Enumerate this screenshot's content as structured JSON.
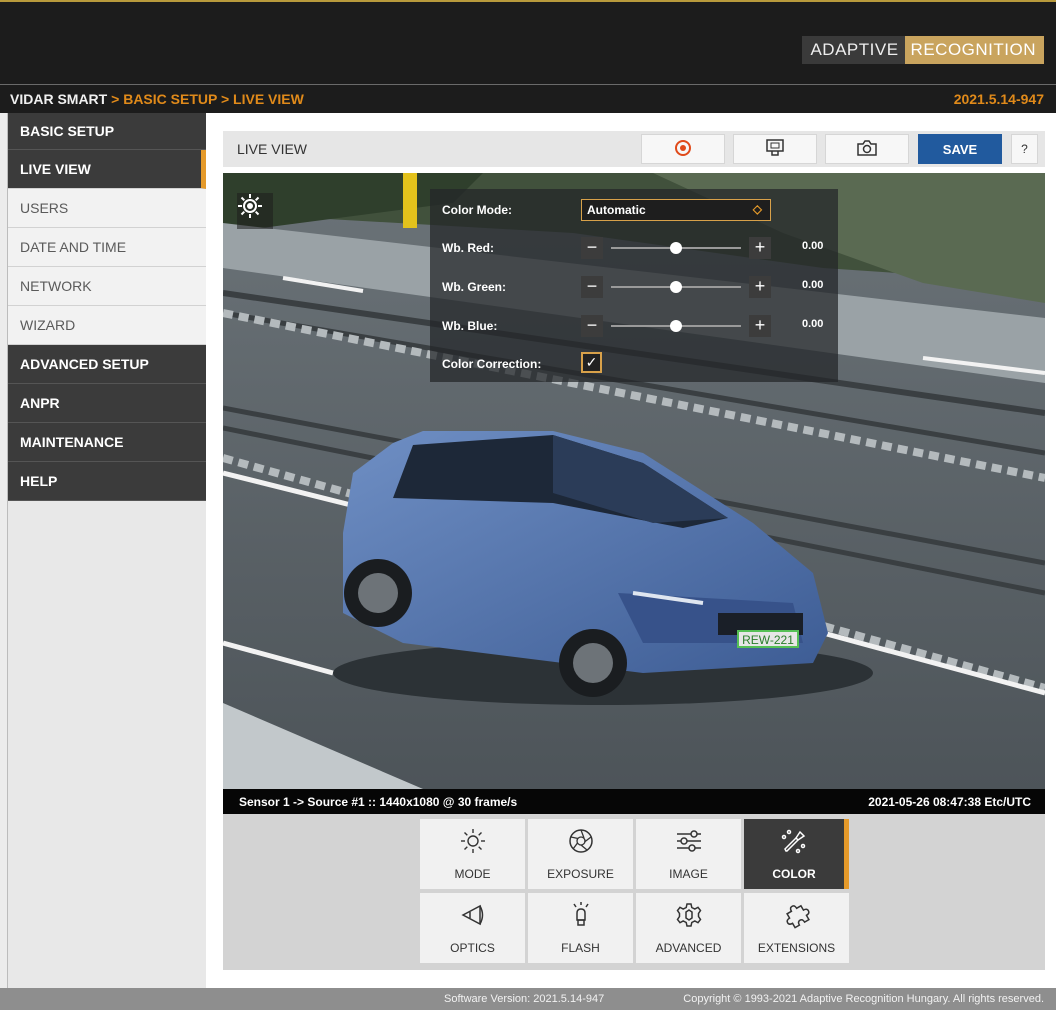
{
  "header": {
    "logo_part1": "ADAPTIVE",
    "logo_part2": "RECOGNITION",
    "breadcrumb_root": "VIDAR SMART",
    "breadcrumb_sep1": " > ",
    "breadcrumb_level1": "BASIC SETUP",
    "breadcrumb_sep2": " > ",
    "breadcrumb_level2": "LIVE VIEW",
    "version": "2021.5.14-947"
  },
  "sidebar": {
    "items": [
      {
        "label": "BASIC SETUP"
      },
      {
        "label": "LIVE VIEW"
      },
      {
        "label": "USERS"
      },
      {
        "label": "DATE AND TIME"
      },
      {
        "label": "NETWORK"
      },
      {
        "label": "WIZARD"
      },
      {
        "label": "ADVANCED SETUP"
      },
      {
        "label": "ANPR"
      },
      {
        "label": "MAINTENANCE"
      },
      {
        "label": "HELP"
      }
    ]
  },
  "toolbar": {
    "title": "LIVE VIEW",
    "save_label": "SAVE",
    "help_label": "?",
    "icons": [
      "record-icon",
      "fullscreen-icon",
      "camera-icon"
    ]
  },
  "color_panel": {
    "color_mode_label": "Color Mode:",
    "color_mode_value": "Automatic",
    "wb_red_label": "Wb. Red:",
    "wb_red_value": "0.00",
    "wb_green_label": "Wb. Green:",
    "wb_green_value": "0.00",
    "wb_blue_label": "Wb. Blue:",
    "wb_blue_value": "0.00",
    "slider_positions": {
      "red": 0.5,
      "green": 0.5,
      "blue": 0.5
    },
    "color_correction_label": "Color Correction:",
    "color_correction_checked": true,
    "minus_label": "−",
    "plus_label": "+"
  },
  "camera": {
    "license_plate": "REW-221",
    "status_left": "Sensor 1 -> Source #1 :: 1440x1080 @ 30 frame/s",
    "status_right": "2021-05-26 08:47:38 Etc/UTC"
  },
  "modes": {
    "tiles": [
      {
        "label": "MODE",
        "icon": "sun-icon"
      },
      {
        "label": "EXPOSURE",
        "icon": "aperture-icon"
      },
      {
        "label": "IMAGE",
        "icon": "sliders-icon"
      },
      {
        "label": "COLOR",
        "icon": "color-picker-icon",
        "active": true
      },
      {
        "label": "OPTICS",
        "icon": "lens-icon"
      },
      {
        "label": "FLASH",
        "icon": "flash-bulb-icon"
      },
      {
        "label": "ADVANCED",
        "icon": "cog-icon"
      },
      {
        "label": "EXTENSIONS",
        "icon": "puzzle-icon"
      }
    ]
  },
  "footer": {
    "software_version": "Software Version:   2021.5.14-947",
    "copyright": "Copyright © 1993-2021 Adaptive Recognition Hungary. All rights reserved."
  },
  "colors": {
    "accent": "#e59a2a",
    "save_button": "#215a9e",
    "sidebar_dark": "#3b3b3b"
  }
}
